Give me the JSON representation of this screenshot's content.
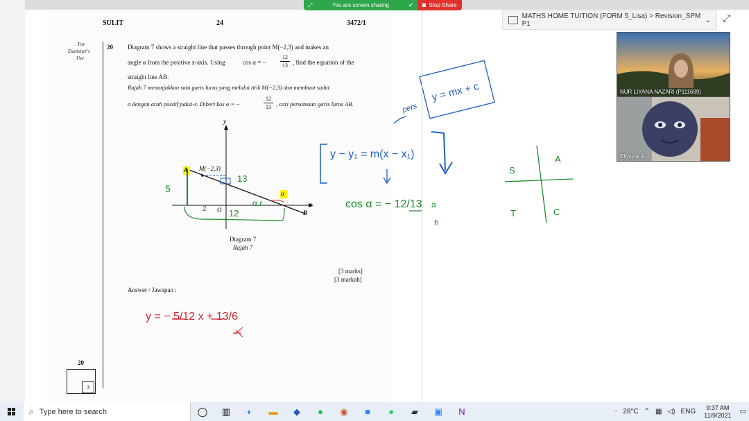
{
  "share_bar": {
    "status": "You are screen sharing",
    "stop_label": "Stop Share"
  },
  "exam": {
    "header_left": "SULIT",
    "header_page": "24",
    "header_code": "3472/1",
    "examiner_label_1": "For",
    "examiner_label_2": "Examiner's",
    "examiner_label_3": "Use",
    "question_number": "20",
    "q_line1": "Diagram 7 shows a straight line that passes through point M(−2,3) and makes an",
    "q_line2a": "angle α from the positive x-axis. Using",
    "q_line2b": "cos α = −",
    "q_line2c": ", find the equation of the",
    "q_line3": "straight line AB.",
    "q_line4": "Rajah 7 menunjukkan satu garis lurus yang melalui titik M(−2,3) dan membuat sudut",
    "q_line5a": "α dengan arah positif paksi-x. Diberi kos α = −",
    "q_line5b": ", cari persamaan garis lurus AB.",
    "frac_num": "12",
    "frac_den": "13",
    "diagram_label": "Diagram 7",
    "rajah_label": "Rajah 7",
    "y_axis": "y",
    "x_axis": "x",
    "origin": "O",
    "point_m": "M(−2,3)",
    "point_a": "A",
    "point_b": "B",
    "alpha": "α",
    "marks_en": "[3 marks]",
    "marks_my": "[3 markah]",
    "answer_label": "Answer / Jawapan :",
    "bottom_q": "20",
    "bottom_box": "3"
  },
  "annotations": {
    "side_5": "5",
    "side_13": "13",
    "side_12": "12",
    "side_2": "2",
    "alpha_r": "α r",
    "answer": "y = − 5/12 x + 13/6",
    "pers": "pers",
    "formula_box": "y = mx + c",
    "point_slope": "y − y₁ = m(x − x₁)",
    "cos_eq": "cos α = − 12/13",
    "a_label": "a",
    "h_label": "h",
    "quad_s": "S",
    "quad_a": "A",
    "quad_t": "T",
    "quad_c": "C"
  },
  "ppt": {
    "title": "MATHS HOME TUITION (FORM 5_Lisa) > Revision_SPM P1"
  },
  "video": [
    {
      "name": "NUR LIYANA NAZARI (P111699)"
    },
    {
      "name": "Ellysyia Is..."
    }
  ],
  "taskbar": {
    "search_placeholder": "Type here to search",
    "weather": "28°C",
    "lang": "ENG",
    "time": "9:37 AM",
    "date": "11/9/2021"
  }
}
